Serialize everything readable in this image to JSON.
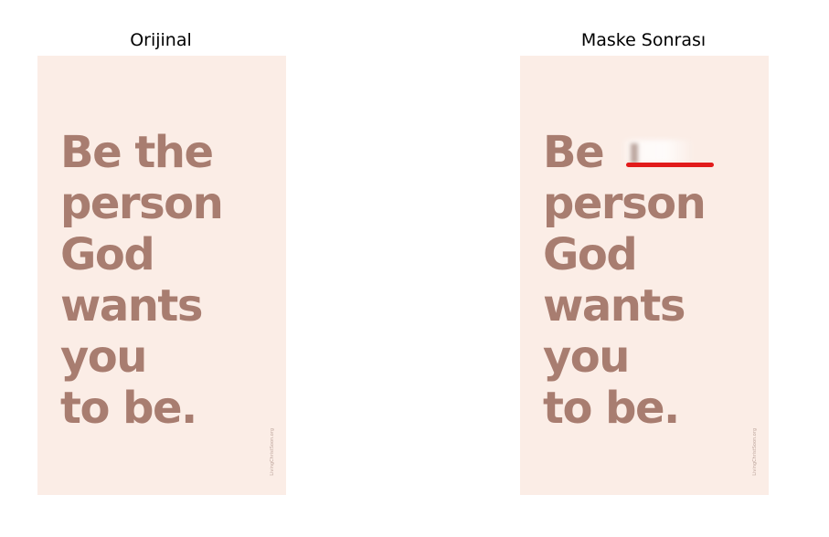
{
  "colors": {
    "poster_bg": "#fbede6",
    "text": "#a87d70",
    "watermark": "#b59c93",
    "mask_line": "#e21b1b"
  },
  "panels": [
    {
      "title": "Orijinal",
      "lines": [
        "Be the",
        "person",
        "God",
        "wants",
        "you",
        "to be."
      ],
      "watermark": "LivingChristSoon.org"
    },
    {
      "title": "Maske Sonrası",
      "line1_prefix": "Be",
      "lines_rest": [
        "person",
        "God",
        "wants",
        "you",
        "to be."
      ],
      "watermark": "LivingChristSoon.org"
    }
  ]
}
